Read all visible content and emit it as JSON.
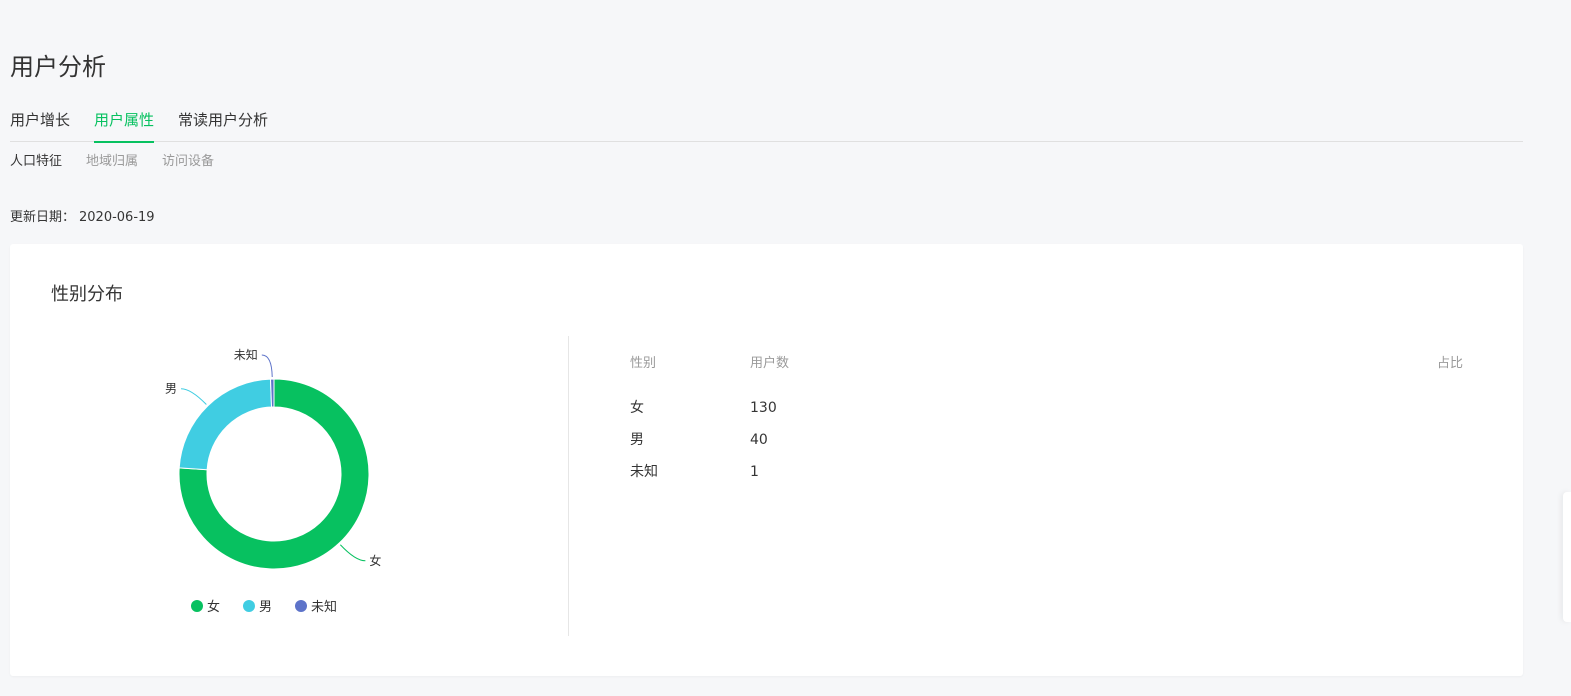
{
  "page": {
    "title": "用户分析"
  },
  "tabs": [
    {
      "label": "用户增长",
      "active": false
    },
    {
      "label": "用户属性",
      "active": true
    },
    {
      "label": "常读用户分析",
      "active": false
    }
  ],
  "subtabs": [
    {
      "label": "人口特征",
      "active": true
    },
    {
      "label": "地域归属",
      "active": false
    },
    {
      "label": "访问设备",
      "active": false
    }
  ],
  "update": {
    "label": "更新日期：",
    "date": "2020-06-19"
  },
  "card": {
    "title": "性别分布"
  },
  "colors": {
    "accent": "#07c160",
    "female": "#07c160",
    "male": "#40cde2",
    "unknown": "#5d73c9"
  },
  "chart_data": {
    "type": "pie",
    "donut": true,
    "categories": [
      "女",
      "男",
      "未知"
    ],
    "values": [
      130,
      40,
      1
    ],
    "colors": [
      "#07c160",
      "#40cde2",
      "#5d73c9"
    ],
    "legend": {
      "placement": "bottom",
      "entries": [
        "女",
        "男",
        "未知"
      ]
    }
  },
  "table": {
    "headers": {
      "gender": "性别",
      "users": "用户数",
      "ratio": "占比"
    },
    "rows": [
      {
        "gender": "女",
        "users": "130",
        "ratio": ""
      },
      {
        "gender": "男",
        "users": "40",
        "ratio": ""
      },
      {
        "gender": "未知",
        "users": "1",
        "ratio": ""
      }
    ]
  }
}
